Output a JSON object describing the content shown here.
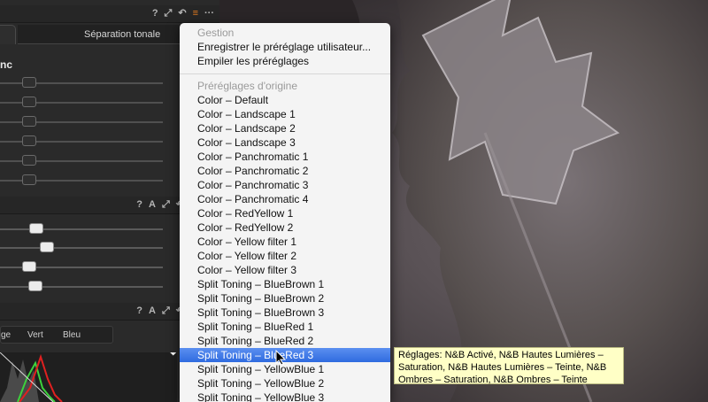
{
  "panel": {
    "tabs": {
      "active_label": "",
      "tonal_label": "Séparation tonale"
    },
    "section_title": "nc",
    "top_icons": [
      "?",
      "⤢",
      "↶",
      "≡",
      "···"
    ],
    "mid_icons": [
      "?",
      "A",
      "⤢",
      "↶"
    ],
    "low_icons": [
      "?",
      "A",
      "⤢",
      "↶"
    ],
    "histogram_channels": {
      "c1": "ge",
      "c2": "Vert",
      "c3": "Bleu"
    }
  },
  "menu": {
    "section1": "Gestion",
    "save_user": "Enregistrer le préréglage utilisateur...",
    "stack": "Empiler les préréglages",
    "section2": "Préréglages d'origine",
    "items": [
      "Color – Default",
      "Color – Landscape 1",
      "Color – Landscape 2",
      "Color – Landscape 3",
      "Color – Panchromatic 1",
      "Color – Panchromatic 2",
      "Color – Panchromatic 3",
      "Color – Panchromatic 4",
      "Color – RedYellow 1",
      "Color – RedYellow 2",
      "Color – Yellow filter 1",
      "Color – Yellow filter 2",
      "Color – Yellow filter 3",
      "Split Toning – BlueBrown 1",
      "Split Toning – BlueBrown 2",
      "Split Toning – BlueBrown 3",
      "Split Toning – BlueRed 1",
      "Split Toning – BlueRed 2",
      "Split Toning – BlueRed 3",
      "Split Toning – YellowBlue 1",
      "Split Toning – YellowBlue 2",
      "Split Toning – YellowBlue 3"
    ],
    "selected_index": 18
  },
  "tooltip": {
    "line1": "Réglages: N&B Activé, N&B Hautes Lumières –",
    "line2": "Saturation, N&B Hautes Lumières – Teinte, N&B",
    "line3": "Ombres – Saturation, N&B Ombres – Teinte"
  },
  "colors": {
    "accent": "#e07a20",
    "selection": "#3a74e6",
    "tooltip_bg": "#ffffc6"
  }
}
